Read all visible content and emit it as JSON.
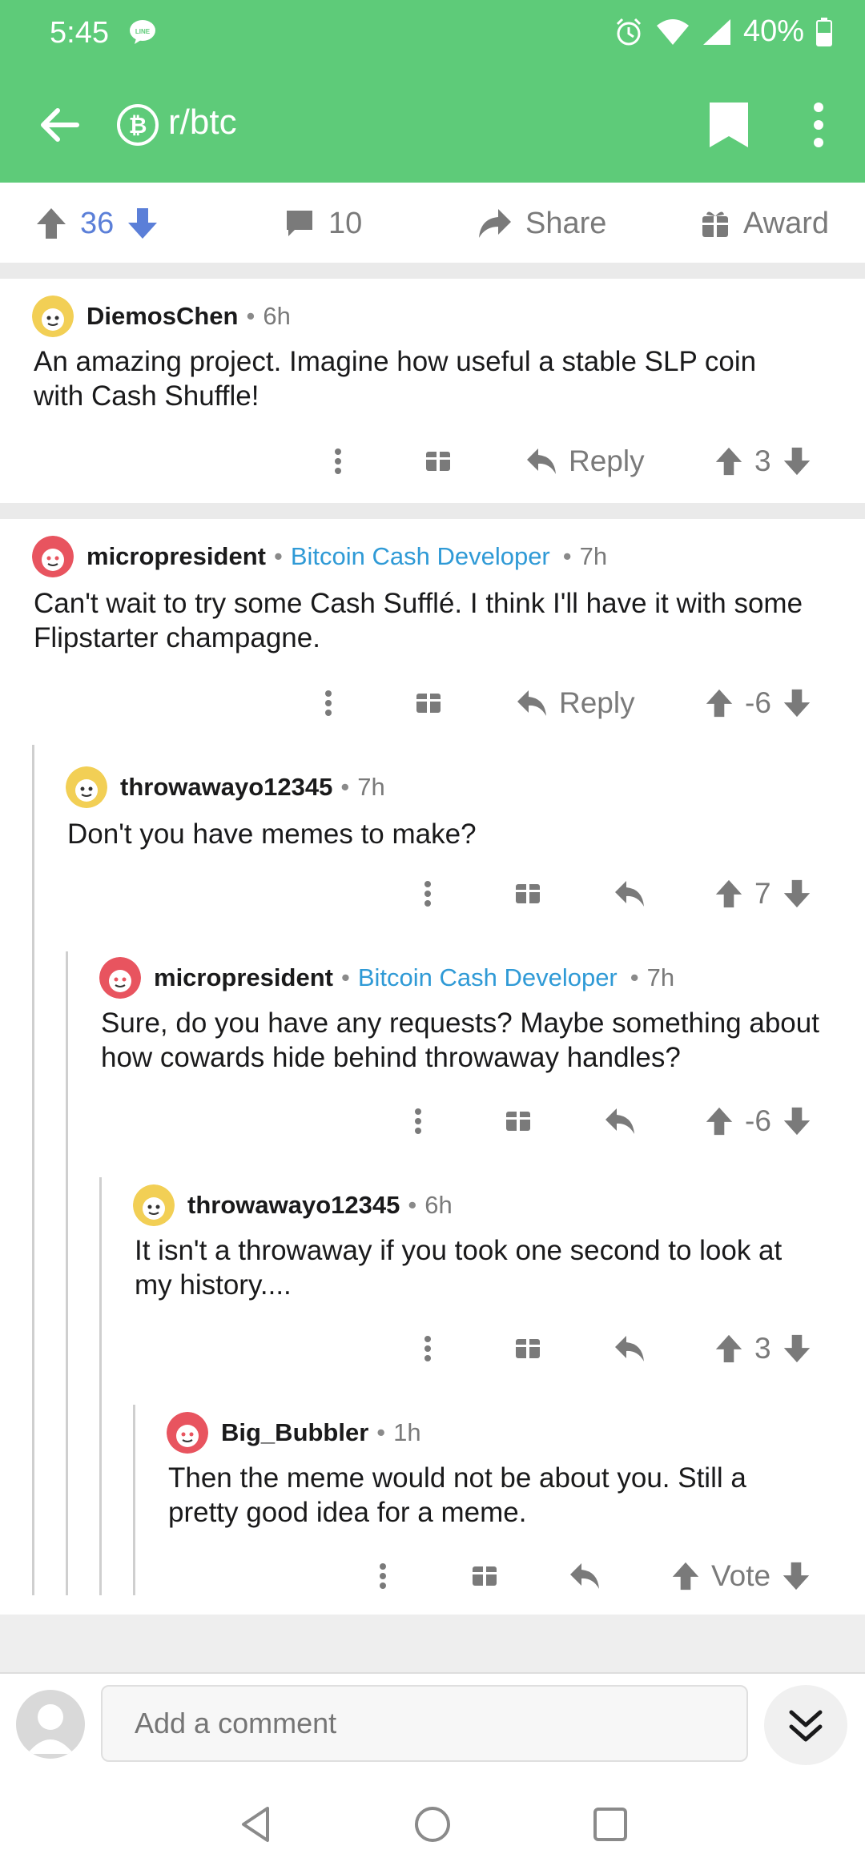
{
  "status": {
    "time": "5:45",
    "battery": "40%"
  },
  "header": {
    "subreddit": "r/btc"
  },
  "post_actions": {
    "score": "36",
    "comments": "10",
    "share": "Share",
    "award": "Award"
  },
  "comments": [
    {
      "author": "DiemosChen",
      "flair": "",
      "age": "6h",
      "line1": "An amazing project. Imagine how useful a stable SLP coin",
      "line2": "with Cash Shuffle!",
      "reply": "Reply",
      "score": "3"
    },
    {
      "author": "micropresident",
      "flair": "Bitcoin Cash Developer",
      "age": "7h",
      "line1": "Can't wait to try some Cash Sufflé. I think I'll have it with some",
      "line2": "Flipstarter champagne.",
      "reply": "Reply",
      "score": "-6"
    },
    {
      "author": "throwawayo12345",
      "flair": "",
      "age": "7h",
      "line1": "Don't you have memes to make?",
      "line2": "",
      "score": "7"
    },
    {
      "author": "micropresident",
      "flair": "Bitcoin Cash Developer",
      "age": "7h",
      "line1": "Sure, do you have any requests? Maybe something about",
      "line2": "how cowards hide behind throwaway handles?",
      "score": "-6"
    },
    {
      "author": "throwawayo12345",
      "flair": "",
      "age": "6h",
      "line1": "It isn't a throwaway if you took one second to look at",
      "line2": "my history....",
      "score": "3"
    },
    {
      "author": "Big_Bubbler",
      "flair": "",
      "age": "1h",
      "line1": "Then the meme would not be about you. Still a",
      "line2": "pretty good idea for a meme.",
      "score": "Vote"
    }
  ],
  "composer": {
    "placeholder": "Add a comment"
  },
  "colors": {
    "header_green": "#5ecb79",
    "upvote_blue": "#5b7fd8",
    "flair_blue": "#2f9ad6"
  }
}
